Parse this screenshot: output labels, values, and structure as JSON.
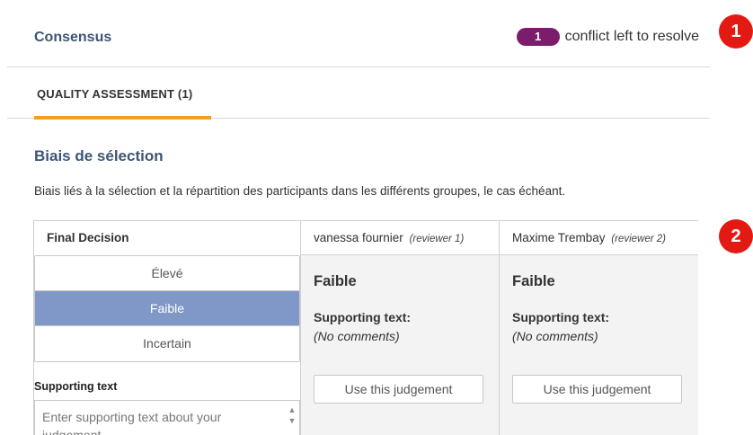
{
  "header": {
    "title": "Consensus",
    "conflict_count": "1",
    "conflict_text": "conflict left to resolve"
  },
  "callouts": [
    "1",
    "2"
  ],
  "tabs": [
    {
      "label": "QUALITY ASSESSMENT (1)",
      "active": true
    }
  ],
  "section": {
    "title": "Biais de sélection",
    "description": "Biais liés à la sélection et la répartition des participants dans les différents groupes, le cas échéant."
  },
  "final_decision": {
    "header": "Final Decision",
    "options": [
      "Élevé",
      "Faible",
      "Incertain"
    ],
    "selected": "Faible",
    "supporting_label": "Supporting text",
    "supporting_placeholder": "Enter supporting text about your judgement"
  },
  "reviewers": [
    {
      "name": "vanessa fournier",
      "role": "(reviewer 1)",
      "decision": "Faible",
      "supporting_label": "Supporting text:",
      "supporting_text": "(No comments)",
      "button": "Use this judgement"
    },
    {
      "name": "Maxime Trembay",
      "role": "(reviewer 2)",
      "decision": "Faible",
      "supporting_label": "Supporting text:",
      "supporting_text": "(No comments)",
      "button": "Use this judgement"
    }
  ],
  "colors": {
    "title": "#3e5576",
    "badge": "#7b1d6c",
    "callout": "#e31a14",
    "tab_underline": "#f4a11a",
    "selected_option": "#8098c8"
  },
  "icons": {
    "scroll_up": "chevron-up-icon",
    "scroll_down": "chevron-down-icon"
  }
}
